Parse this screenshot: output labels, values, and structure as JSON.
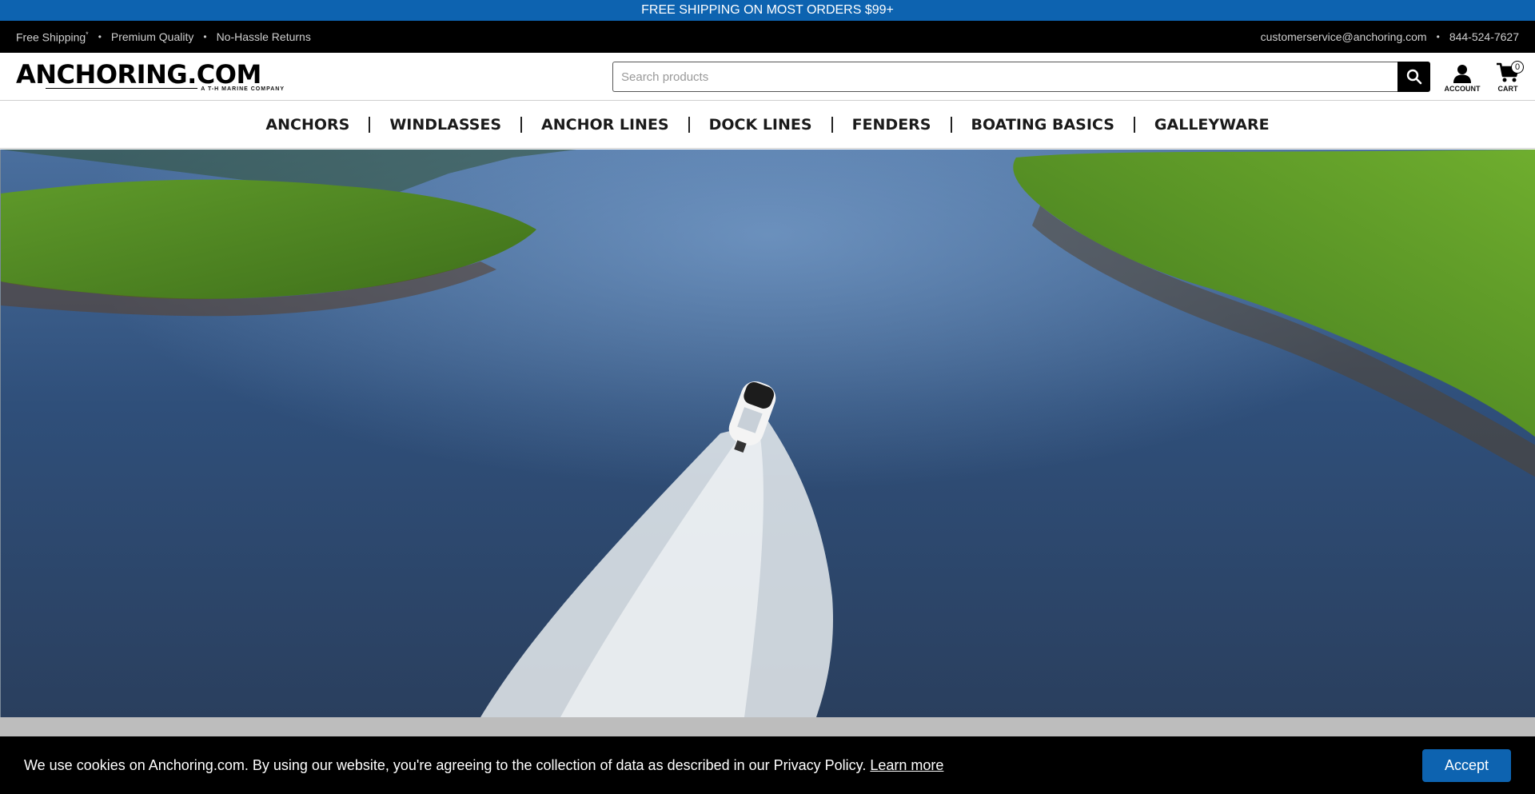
{
  "promo": {
    "text": "FREE SHIPPING ON MOST ORDERS $99+"
  },
  "utility": {
    "left": [
      "Free Shipping",
      "Premium Quality",
      "No-Hassle Returns"
    ],
    "free_shipping_mark": "*",
    "email": "customerservice@anchoring.com",
    "phone": "844-524-7627"
  },
  "header": {
    "logo_text": "ANCHORING.COM",
    "logo_sub": "A T-H MARINE COMPANY",
    "search_placeholder": "Search products",
    "account_label": "ACCOUNT",
    "cart_label": "CART",
    "cart_count": "0"
  },
  "nav": {
    "items": [
      "ANCHORS",
      "WINDLASSES",
      "ANCHOR LINES",
      "DOCK LINES",
      "FENDERS",
      "BOATING BASICS",
      "GALLEYWARE"
    ]
  },
  "cookie": {
    "text": "We use cookies on Anchoring.com. By using our website, you're agreeing to the collection of data as described in our Privacy Policy.",
    "link": "Learn more",
    "accept": "Accept"
  },
  "colors": {
    "brand_blue": "#0d63b0",
    "black": "#000000"
  },
  "icons": [
    "search-icon",
    "account-icon",
    "cart-icon",
    "anchor-icon"
  ]
}
